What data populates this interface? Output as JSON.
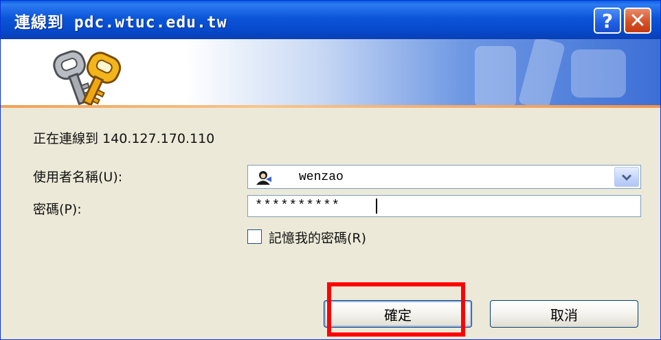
{
  "window": {
    "title": "連線到 pdc.wtuc.edu.tw",
    "help_label": "?",
    "close_label": "✕"
  },
  "icons": {
    "keys": "keys-icon",
    "watermark": "keys-watermark-icon",
    "user": "user-account-icon",
    "dropdown": "chevron-down-icon"
  },
  "message": "正在連線到 140.127.170.110",
  "form": {
    "username_label": "使用者名稱(U):",
    "username_value": "wenzao",
    "password_label": "密碼(P):",
    "password_value": "**********",
    "remember_label": "記憶我的密碼(R)",
    "remember_checked": false
  },
  "buttons": {
    "ok": "確定",
    "cancel": "取消"
  },
  "colors": {
    "title_bar": "#0b55d8",
    "dialog_bg": "#ece9d8",
    "accent_stripe": "#f1a155",
    "highlight": "#ff0000",
    "close_button": "#d65127"
  }
}
